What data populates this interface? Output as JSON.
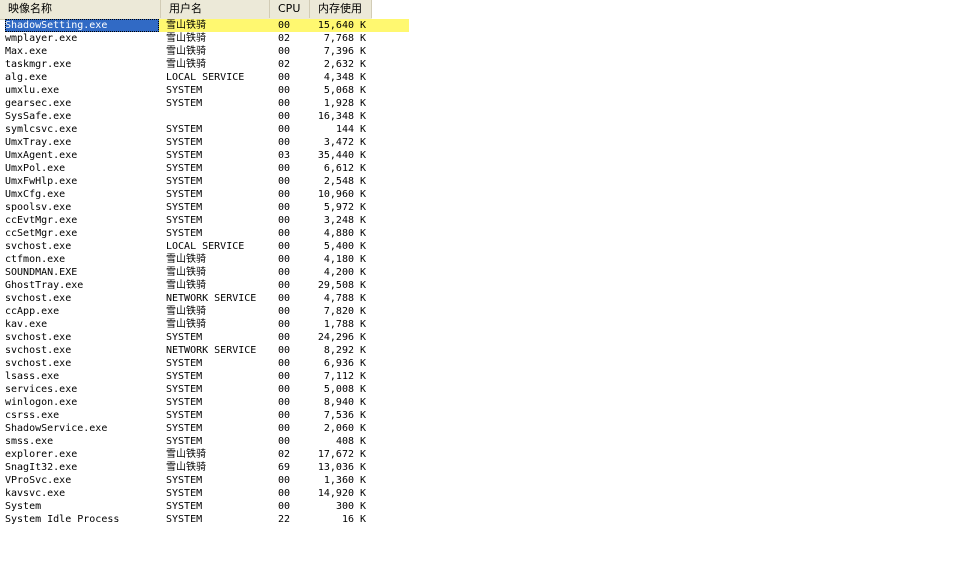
{
  "header": {
    "name": "映像名称",
    "user": "用户名",
    "cpu": "CPU",
    "mem": "内存使用"
  },
  "colors": {
    "header_bg": "#ece9d8",
    "selection": "#316ac5",
    "highlight": "#fff870"
  },
  "processes": [
    {
      "name": "ShadowSetting.exe",
      "user": "雪山铁骑",
      "cpu": "00",
      "mem": "15,640",
      "unit": "K",
      "selected": true
    },
    {
      "name": "wmplayer.exe",
      "user": "雪山铁骑",
      "cpu": "02",
      "mem": "7,768",
      "unit": "K"
    },
    {
      "name": "Max.exe",
      "user": "雪山铁骑",
      "cpu": "00",
      "mem": "7,396",
      "unit": "K"
    },
    {
      "name": "taskmgr.exe",
      "user": "雪山铁骑",
      "cpu": "02",
      "mem": "2,632",
      "unit": "K"
    },
    {
      "name": "alg.exe",
      "user": "LOCAL SERVICE",
      "cpu": "00",
      "mem": "4,348",
      "unit": "K"
    },
    {
      "name": "umxlu.exe",
      "user": "SYSTEM",
      "cpu": "00",
      "mem": "5,068",
      "unit": "K"
    },
    {
      "name": "gearsec.exe",
      "user": "SYSTEM",
      "cpu": "00",
      "mem": "1,928",
      "unit": "K"
    },
    {
      "name": "SysSafe.exe",
      "user": "",
      "cpu": "00",
      "mem": "16,348",
      "unit": "K"
    },
    {
      "name": "symlcsvc.exe",
      "user": "SYSTEM",
      "cpu": "00",
      "mem": "144",
      "unit": "K"
    },
    {
      "name": "UmxTray.exe",
      "user": "SYSTEM",
      "cpu": "00",
      "mem": "3,472",
      "unit": "K"
    },
    {
      "name": "UmxAgent.exe",
      "user": "SYSTEM",
      "cpu": "03",
      "mem": "35,440",
      "unit": "K"
    },
    {
      "name": "UmxPol.exe",
      "user": "SYSTEM",
      "cpu": "00",
      "mem": "6,612",
      "unit": "K"
    },
    {
      "name": "UmxFwHlp.exe",
      "user": "SYSTEM",
      "cpu": "00",
      "mem": "2,548",
      "unit": "K"
    },
    {
      "name": "UmxCfg.exe",
      "user": "SYSTEM",
      "cpu": "00",
      "mem": "10,960",
      "unit": "K"
    },
    {
      "name": "spoolsv.exe",
      "user": "SYSTEM",
      "cpu": "00",
      "mem": "5,972",
      "unit": "K"
    },
    {
      "name": "ccEvtMgr.exe",
      "user": "SYSTEM",
      "cpu": "00",
      "mem": "3,248",
      "unit": "K"
    },
    {
      "name": "ccSetMgr.exe",
      "user": "SYSTEM",
      "cpu": "00",
      "mem": "4,880",
      "unit": "K"
    },
    {
      "name": "svchost.exe",
      "user": "LOCAL SERVICE",
      "cpu": "00",
      "mem": "5,400",
      "unit": "K"
    },
    {
      "name": "ctfmon.exe",
      "user": "雪山铁骑",
      "cpu": "00",
      "mem": "4,180",
      "unit": "K"
    },
    {
      "name": "SOUNDMAN.EXE",
      "user": "雪山铁骑",
      "cpu": "00",
      "mem": "4,200",
      "unit": "K"
    },
    {
      "name": "GhostTray.exe",
      "user": "雪山铁骑",
      "cpu": "00",
      "mem": "29,508",
      "unit": "K"
    },
    {
      "name": "svchost.exe",
      "user": "NETWORK SERVICE",
      "cpu": "00",
      "mem": "4,788",
      "unit": "K"
    },
    {
      "name": "ccApp.exe",
      "user": "雪山铁骑",
      "cpu": "00",
      "mem": "7,820",
      "unit": "K"
    },
    {
      "name": "kav.exe",
      "user": "雪山铁骑",
      "cpu": "00",
      "mem": "1,788",
      "unit": "K"
    },
    {
      "name": "svchost.exe",
      "user": "SYSTEM",
      "cpu": "00",
      "mem": "24,296",
      "unit": "K"
    },
    {
      "name": "svchost.exe",
      "user": "NETWORK SERVICE",
      "cpu": "00",
      "mem": "8,292",
      "unit": "K"
    },
    {
      "name": "svchost.exe",
      "user": "SYSTEM",
      "cpu": "00",
      "mem": "6,936",
      "unit": "K"
    },
    {
      "name": "lsass.exe",
      "user": "SYSTEM",
      "cpu": "00",
      "mem": "7,112",
      "unit": "K"
    },
    {
      "name": "services.exe",
      "user": "SYSTEM",
      "cpu": "00",
      "mem": "5,008",
      "unit": "K"
    },
    {
      "name": "winlogon.exe",
      "user": "SYSTEM",
      "cpu": "00",
      "mem": "8,940",
      "unit": "K"
    },
    {
      "name": "csrss.exe",
      "user": "SYSTEM",
      "cpu": "00",
      "mem": "7,536",
      "unit": "K"
    },
    {
      "name": "ShadowService.exe",
      "user": "SYSTEM",
      "cpu": "00",
      "mem": "2,060",
      "unit": "K"
    },
    {
      "name": "smss.exe",
      "user": "SYSTEM",
      "cpu": "00",
      "mem": "408",
      "unit": "K"
    },
    {
      "name": "explorer.exe",
      "user": "雪山铁骑",
      "cpu": "02",
      "mem": "17,672",
      "unit": "K"
    },
    {
      "name": "SnagIt32.exe",
      "user": "雪山铁骑",
      "cpu": "69",
      "mem": "13,036",
      "unit": "K"
    },
    {
      "name": "VProSvc.exe",
      "user": "SYSTEM",
      "cpu": "00",
      "mem": "1,360",
      "unit": "K"
    },
    {
      "name": "kavsvc.exe",
      "user": "SYSTEM",
      "cpu": "00",
      "mem": "14,920",
      "unit": "K"
    },
    {
      "name": "System",
      "user": "SYSTEM",
      "cpu": "00",
      "mem": "300",
      "unit": "K"
    },
    {
      "name": "System Idle Process",
      "user": "SYSTEM",
      "cpu": "22",
      "mem": "16",
      "unit": "K"
    }
  ]
}
